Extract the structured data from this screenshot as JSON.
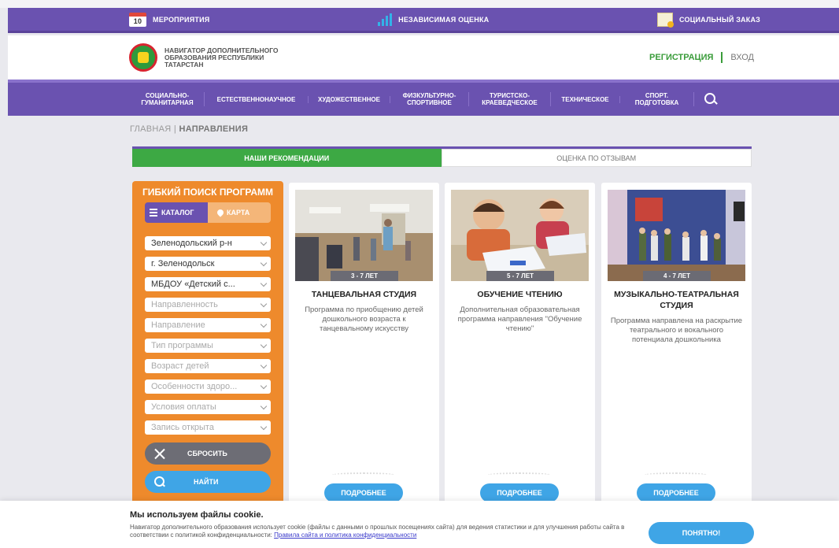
{
  "topbar": {
    "events": {
      "label": "МЕРОПРИЯТИЯ",
      "day": "10"
    },
    "rating": {
      "label": "НЕЗАВИСИМАЯ ОЦЕНКА"
    },
    "order": {
      "label": "СОЦИАЛЬНЫЙ ЗАКАЗ"
    }
  },
  "header": {
    "site_name": "НАВИГАТОР ДОПОЛНИТЕЛЬНОГО ОБРАЗОВАНИЯ РЕСПУБЛИКИ ТАТАРСТАН",
    "register": "РЕГИСТРАЦИЯ",
    "login": "ВХОД"
  },
  "nav": [
    "СОЦИАЛЬНО-ГУМАНИТАРНАЯ",
    "ЕСТЕСТВЕННОНАУЧНОЕ",
    "ХУДОЖЕСТВЕННОЕ",
    "ФИЗКУЛЬТУРНО-СПОРТИВНОЕ",
    "ТУРИСТСКО-КРАЕВЕДЧЕСКОЕ",
    "ТЕХНИЧЕСКОЕ",
    "СПОРТ. ПОДГОТОВКА"
  ],
  "breadcrumb": {
    "home": "ГЛАВНАЯ",
    "sep": "|",
    "current": "НАПРАВЛЕНИЯ"
  },
  "tabs": {
    "recommend": "НАШИ РЕКОМЕНДАЦИИ",
    "reviews": "ОЦЕНКА ПО ОТЗЫВАМ"
  },
  "filter": {
    "title": "ГИБКИЙ ПОИСК ПРОГРАММ",
    "catalog": "КАТАЛОГ",
    "map": "КАРТА",
    "selects": [
      "Зеленодольский р-н",
      "г. Зеленодольск",
      "МБДОУ «Детский с...",
      "Направленность",
      "Направление",
      "Тип программы",
      "Возраст детей",
      "Особенности здоро...",
      "Условия оплаты",
      "Запись открыта"
    ],
    "reset": "СБРОСИТЬ",
    "find": "НАЙТИ"
  },
  "cards": [
    {
      "age": "3 - 7 ЛЕТ",
      "title": "ТАНЦЕВАЛЬНАЯ СТУДИЯ",
      "desc": "Программа по приобщению детей дошкольного возраста к танцевальному искусству",
      "more": "ПОДРОБНЕЕ"
    },
    {
      "age": "5 - 7 ЛЕТ",
      "title": "ОБУЧЕНИЕ ЧТЕНИЮ",
      "desc": "Дополнительная образовательная программа направления \"Обучение чтению\"",
      "more": "ПОДРОБНЕЕ"
    },
    {
      "age": "4 - 7 ЛЕТ",
      "title": "МУЗЫКАЛЬНО-ТЕАТРАЛЬНАЯ СТУДИЯ",
      "desc": "Программа направлена на раскрытие театрального и вокального потенциала дошкольника",
      "more": "ПОДРОБНЕЕ"
    }
  ],
  "cookie": {
    "title": "Мы используем файлы cookie.",
    "text": "Навигатор дополнительного образования использует cookie (файлы с данными о прошлых посещениях сайта) для ведения статистики и для улучшения работы сайта в соответствии с политикой конфиденциальности: ",
    "link": "Правила сайта и политика конфиденциальности",
    "button": "ПОНЯТНО!"
  },
  "colors": {
    "purple": "#6a52b0",
    "green": "#3da944",
    "orange": "#ee8a2c",
    "blue": "#3fa5e6"
  }
}
